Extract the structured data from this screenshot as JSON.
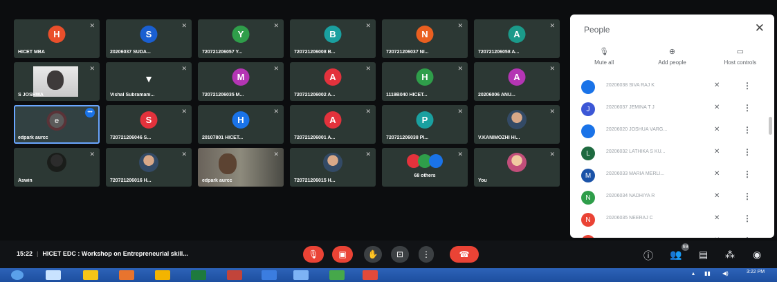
{
  "tiles": [
    {
      "type": "avatar",
      "initial": "H",
      "color": "#ea4f2b",
      "name": "HICET MBA"
    },
    {
      "type": "avatar",
      "initial": "S",
      "color": "#1a5fd1",
      "name": "20206037 SUDA..."
    },
    {
      "type": "avatar",
      "initial": "Y",
      "color": "#2f9e4a",
      "name": "720721206057 Y..."
    },
    {
      "type": "avatar",
      "initial": "B",
      "color": "#1aa0a0",
      "name": "720721206008 B..."
    },
    {
      "type": "avatar",
      "initial": "N",
      "color": "#ea5f20",
      "name": "720721206037 NI..."
    },
    {
      "type": "avatar",
      "initial": "A",
      "color": "#1b9a8a",
      "name": "720721206058 A..."
    },
    {
      "type": "camera",
      "name": "S JOSHWA"
    },
    {
      "type": "logo",
      "name": "Vishal Subramani..."
    },
    {
      "type": "avatar",
      "initial": "M",
      "color": "#b435b4",
      "name": "720721206035 M..."
    },
    {
      "type": "avatar",
      "initial": "A",
      "color": "#e3323c",
      "name": "720721206002 A..."
    },
    {
      "type": "avatar",
      "initial": "H",
      "color": "#2f9e4a",
      "name": "1119B040 HICET..."
    },
    {
      "type": "avatar",
      "initial": "A",
      "color": "#b435b4",
      "name": "20206006 ANU..."
    },
    {
      "type": "speaking",
      "initial": "e",
      "name": "edpark aurcc"
    },
    {
      "type": "avatar",
      "initial": "S",
      "color": "#e3323c",
      "name": "720721206046 S..."
    },
    {
      "type": "avatar",
      "initial": "H",
      "color": "#1a73e8",
      "name": "20107801 HICET..."
    },
    {
      "type": "avatar",
      "initial": "A",
      "color": "#e3323c",
      "name": "720721206001 A..."
    },
    {
      "type": "avatar",
      "initial": "P",
      "color": "#1aa0a0",
      "name": "720721206038 PI..."
    },
    {
      "type": "photo",
      "name": "V.KANIMOZHI HI..."
    },
    {
      "type": "photo-dark",
      "name": "Aswin"
    },
    {
      "type": "photo",
      "name": "720721206016 H..."
    },
    {
      "type": "video",
      "name": "edpark aurcc"
    },
    {
      "type": "photo",
      "name": "720721206015 H..."
    },
    {
      "type": "others",
      "name": "68 others"
    },
    {
      "type": "photo-warm",
      "name": "You"
    }
  ],
  "panel": {
    "title": "People",
    "close": "✕",
    "actions": [
      {
        "icon": "mic-off-icon",
        "glyph": "🎙̸",
        "label": "Mute all"
      },
      {
        "icon": "add-person-icon",
        "glyph": "👤+",
        "label": "Add people"
      },
      {
        "icon": "host-controls-icon",
        "glyph": "⊟",
        "label": "Host controls"
      }
    ],
    "people": [
      {
        "initial": "",
        "color": "#1a73e8",
        "name": "20206038 SIVA RAJ K"
      },
      {
        "initial": "J",
        "color": "#3c57d6",
        "name": "20206037 JEMINA T J"
      },
      {
        "initial": "",
        "color": "#1a73e8",
        "name": "20206020 JOSHUA VARG..."
      },
      {
        "initial": "L",
        "color": "#1e6a40",
        "name": "20206032 LATHIKA S KU..."
      },
      {
        "initial": "M",
        "color": "#1b53a8",
        "name": "20206033 MARIA MERLI..."
      },
      {
        "initial": "N",
        "color": "#2f9e4a",
        "name": "20206034 NADHIYA R"
      },
      {
        "initial": "N",
        "color": "#ea4335",
        "name": "20206035 NEERAJ C"
      },
      {
        "initial": "",
        "color": "#ea4335",
        "name": "20206036 ..."
      }
    ]
  },
  "bottom": {
    "time": "15:22",
    "meeting_title": "HICET EDC : Workshop on Entrepreneurial skill..."
  },
  "taskbar": {
    "time": "3:22 PM"
  }
}
